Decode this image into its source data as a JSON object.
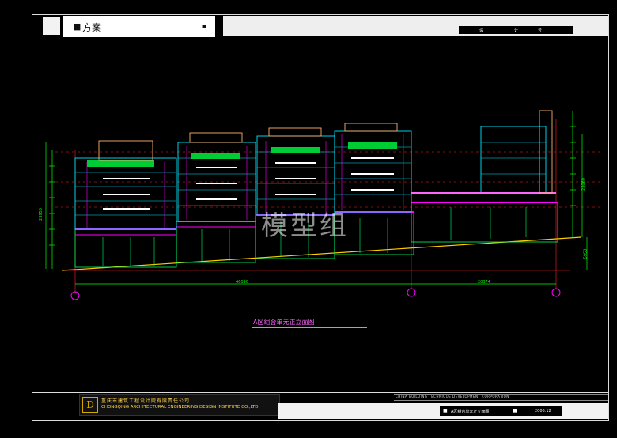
{
  "header": {
    "scheme_label": "方案",
    "sheet_codes": [
      "设",
      "计",
      "号"
    ]
  },
  "drawing": {
    "title": "A区组合单元正立面图",
    "dimensions": {
      "left_span": "46090",
      "right_span": "20374",
      "right_total": "23060",
      "left_total": "23950",
      "ground_offset": "5950"
    }
  },
  "watermark": "模型组",
  "footer": {
    "company_cn": "重庆市建筑工程设计院有限责任公司",
    "company_en": "CHONGQING ARCHITECTURAL ENGINEERING DESIGN INSTITUTE CO.,LTD",
    "corp_line": "CHINA BUILDING TECHNIQUE DEVELOPMENT CORPORATION",
    "sheet_name": "A区组合单元正立面图",
    "date": "2006.12"
  },
  "colors": {
    "background": "#000000",
    "building": "#00e5ff",
    "balcony": "#ff00ff",
    "roof_green": "#00ff00",
    "dimension": "#00ff00",
    "grid": "#ff2020",
    "title": "#ff66ff"
  }
}
